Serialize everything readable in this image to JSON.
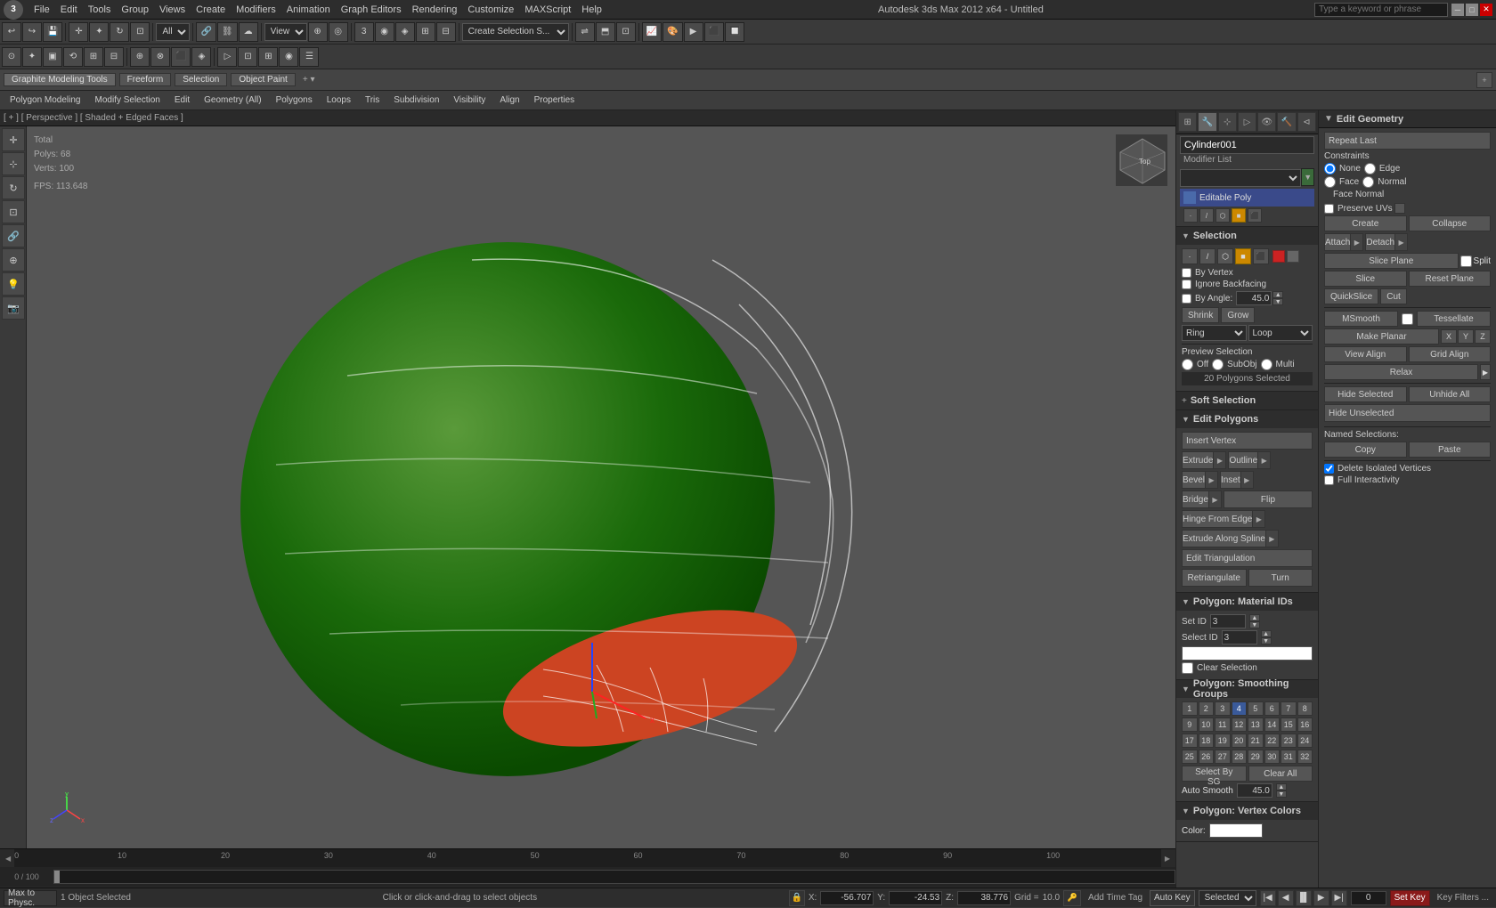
{
  "app": {
    "title": "Autodesk 3ds Max 2012 x64 - Untitled",
    "search_placeholder": "Type a keyword or phrase"
  },
  "menu": {
    "items": [
      "File",
      "Edit",
      "Tools",
      "Group",
      "Views",
      "Create",
      "Modifiers",
      "Animation",
      "Graph Editors",
      "Rendering",
      "Customize",
      "MAXScript",
      "Help"
    ]
  },
  "graphite_bar": {
    "tabs": [
      "Graphite Modeling Tools",
      "Freeform",
      "Selection",
      "Object Paint"
    ],
    "extra": "+ ▾"
  },
  "sub_toolbar": {
    "tabs": [
      "Polygon Modeling",
      "Modify Selection",
      "Edit",
      "Geometry (All)",
      "Polygons",
      "Loops",
      "Tris",
      "Subdivision",
      "Visibility",
      "Align",
      "Properties"
    ]
  },
  "viewport": {
    "path": "[ + ] [ Perspective ] [ Shaded + Edged Faces ]",
    "stats": {
      "polys_label": "Polys:",
      "polys_value": "68",
      "verts_label": "Verts:",
      "verts_value": "100",
      "fps_label": "FPS:",
      "fps_value": "113.648",
      "total_label": "Total"
    }
  },
  "object": {
    "name": "Cylinder001",
    "modifier_list_label": "Modifier List",
    "editable_poly": "Editable Poly"
  },
  "selection_panel": {
    "title": "Selection",
    "by_vertex": "By Vertex",
    "ignore_backfacing": "Ignore Backfacing",
    "by_angle_label": "By Angle:",
    "by_angle_value": "45.0",
    "shrink": "Shrink",
    "grow": "Grow",
    "ring": "Ring",
    "loop": "Loop",
    "preview_label": "Preview Selection",
    "off_label": "Off",
    "subobj_label": "SubObj",
    "multi_label": "Multi",
    "count": "20 Polygons Selected"
  },
  "soft_selection": {
    "title": "Soft Selection"
  },
  "edit_polygons": {
    "title": "Edit Polygons",
    "insert_vertex": "Insert Vertex",
    "extrude": "Extrude",
    "outline": "Outline",
    "bevel": "Bevel",
    "inset": "Inset",
    "bridge": "Bridge",
    "flip": "Flip",
    "hinge_from_edge": "Hinge From Edge",
    "extrude_along_spline": "Extrude Along Spline",
    "edit_triangulation": "Edit Triangulation",
    "retriangulate": "Retriangulate",
    "turn": "Turn"
  },
  "edit_geometry": {
    "title": "Edit Geometry",
    "repeat_last": "Repeat Last",
    "constraints_label": "Constraints",
    "none_label": "None",
    "edge_label": "Edge",
    "face_label": "Face",
    "normal_label": "Normal",
    "preserve_uvs": "Preserve UVs",
    "create": "Create",
    "collapse": "Collapse",
    "attach": "Attach",
    "detach": "Detach",
    "slice_plane": "Slice Plane",
    "split": "Split",
    "slice": "Slice",
    "reset_plane": "Reset Plane",
    "quickslice": "QuickSlice",
    "cut": "Cut",
    "msmooth": "MSmooth",
    "tessellate": "Tessellate",
    "make_planar": "Make Planar",
    "x": "X",
    "y": "Y",
    "z": "Z",
    "view_align": "View Align",
    "grid_align": "Grid Align",
    "relax": "Relax",
    "hide_selected": "Hide Selected",
    "unhide_all": "Unhide All",
    "hide_unselected": "Hide Unselected",
    "named_selections": "Named Selections:",
    "copy": "Copy",
    "paste": "Paste",
    "delete_isolated": "Delete Isolated Vertices",
    "full_interactivity": "Full Interactivity"
  },
  "polygon_material_ids": {
    "title": "Polygon: Material IDs",
    "set_id_label": "Set ID",
    "set_id_value": "3",
    "select_id_label": "Select ID",
    "select_id_value": "3",
    "clear_selection": "Clear Selection"
  },
  "smoothing_groups": {
    "title": "Polygon: Smoothing Groups",
    "buttons": [
      "1",
      "2",
      "3",
      "4",
      "5",
      "6",
      "7",
      "8",
      "9",
      "10",
      "11",
      "12",
      "13",
      "14",
      "15",
      "16",
      "17",
      "18",
      "19",
      "20",
      "21",
      "22",
      "23",
      "24",
      "25",
      "26",
      "27",
      "28",
      "29",
      "30",
      "31",
      "32"
    ],
    "active": [
      4
    ],
    "select_by_sg": "Select By SG",
    "clear_all": "Clear All",
    "auto_smooth_label": "Auto Smooth",
    "auto_smooth_value": "45.0"
  },
  "vertex_colors": {
    "title": "Polygon: Vertex Colors",
    "color_label": "Color:"
  },
  "face_normal": {
    "label": "Face Normal"
  },
  "status_bar": {
    "objects_selected": "1 Object Selected",
    "instruction": "Click or click-and-drag to select objects",
    "lock_icon": "🔒",
    "x_label": "X:",
    "x_value": "-56.707",
    "y_label": "Y:",
    "y_value": "-24.53",
    "z_label": "Z:",
    "z_value": "38.776",
    "grid_label": "Grid =",
    "grid_value": "10.0",
    "autokey_label": "Auto Key",
    "selected_label": "Selected",
    "set_key_label": "Set Key",
    "key_filters_label": "Key Filters ..."
  },
  "timeline": {
    "current_frame": "0",
    "total_frames": "100",
    "tick_marks": [
      "0",
      "10",
      "20",
      "30",
      "40",
      "50",
      "60",
      "70",
      "80",
      "90",
      "100"
    ]
  }
}
